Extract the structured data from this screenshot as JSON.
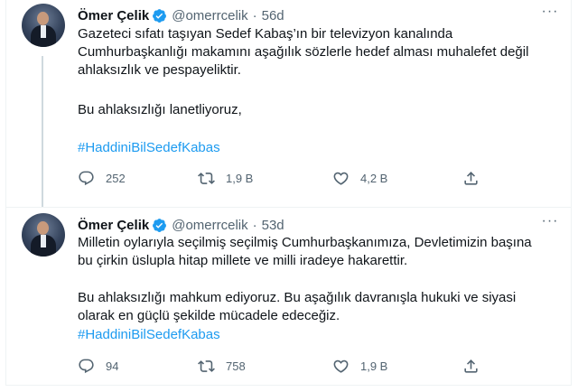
{
  "tweets": [
    {
      "author": "Ömer Çelik",
      "handle": "@omerrcelik",
      "sep": "·",
      "time": "56d",
      "lines": [
        "Gazeteci sıfatı taşıyan Sedef Kabaş’ın bir televizyon kanalında",
        "Cumhurbaşkanlığı  makamını aşağılık sözlerle hedef alması muhalefet değil",
        "ahlaksızlık ve pespayeliktir."
      ],
      "line2": "Bu ahlaksızlığı lanetliyoruz,",
      "hashtag": "#HaddiniBilSedefKabas",
      "replies": "252",
      "retweets": "1,9 B",
      "likes": "4,2 B"
    },
    {
      "author": "Ömer Çelik",
      "handle": "@omerrcelik",
      "sep": "·",
      "time": "53d",
      "lines": [
        "Milletin oylarıyla seçilmiş seçilmiş Cumhurbaşkanımıza, Devletimizin başına",
        "bu çirkin üslupla hitap millete ve milli iradeye hakarettir."
      ],
      "para2": [
        "Bu ahlaksızlığı mahkum ediyoruz. Bu aşağılık davranışla hukuki ve siyasi",
        "olarak en güçlü şekilde mücadele edeceğiz."
      ],
      "hashtag": "#HaddiniBilSedefKabas",
      "replies": "94",
      "retweets": "758",
      "likes": "1,9 B"
    }
  ],
  "icons": {
    "verified": "verified-badge-icon",
    "more": "more-icon",
    "reply": "reply-icon",
    "retweet": "retweet-icon",
    "like": "like-icon",
    "share": "share-icon"
  },
  "colors": {
    "accent": "#1d9bf0",
    "secondary_text": "#536471",
    "text": "#0f1419"
  }
}
